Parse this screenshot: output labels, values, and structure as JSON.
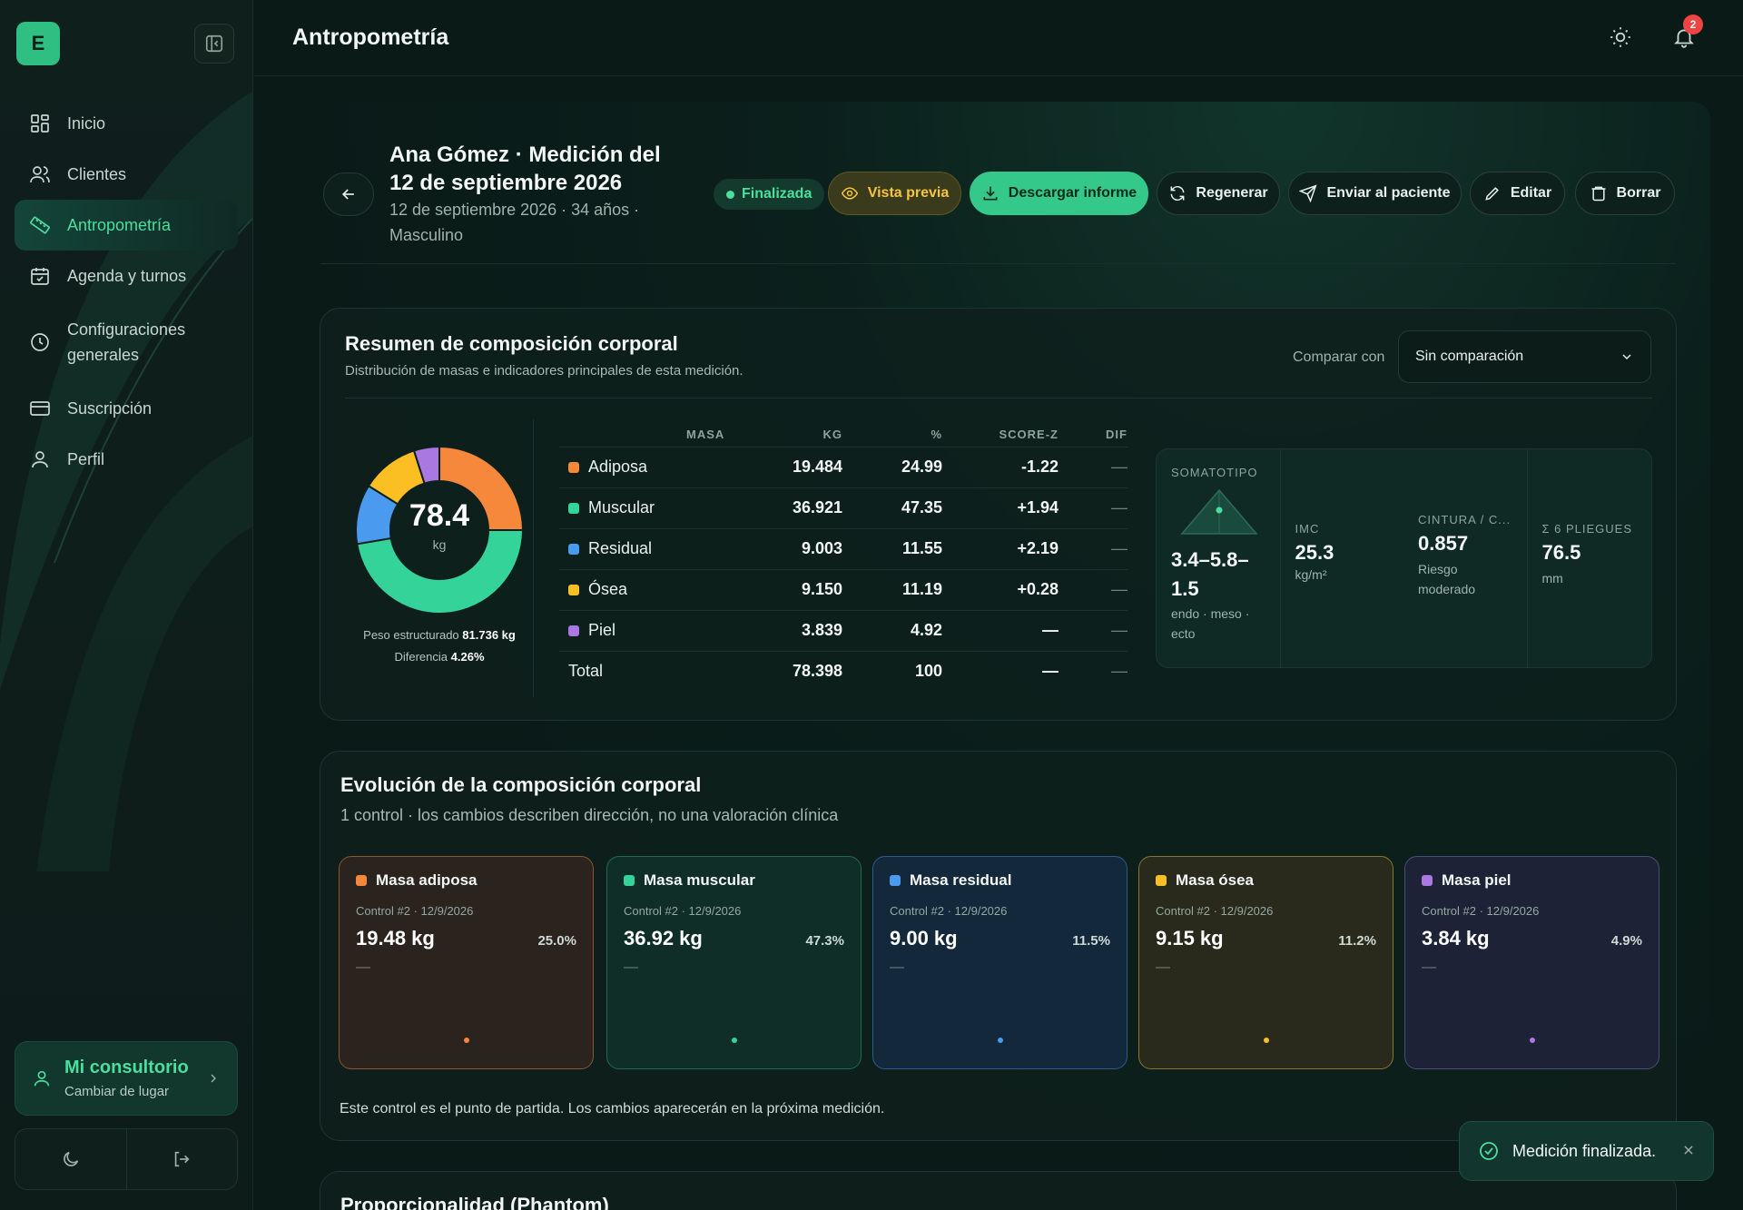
{
  "app": {
    "logo_letter": "E"
  },
  "sidebar": {
    "items": [
      {
        "label": "Inicio",
        "icon": "grid-icon"
      },
      {
        "label": "Clientes",
        "icon": "users-icon"
      },
      {
        "label": "Antropometría",
        "icon": "ruler-icon"
      },
      {
        "label": "Agenda y turnos",
        "icon": "calendar-icon"
      },
      {
        "label": "Configuraciones generales",
        "icon": "clock-icon"
      },
      {
        "label": "Suscripción",
        "icon": "card-icon"
      },
      {
        "label": "Perfil",
        "icon": "user-icon"
      }
    ],
    "active_index": 2,
    "consultorio": {
      "title": "Mi consultorio",
      "subtitle": "Cambiar de lugar"
    }
  },
  "header": {
    "title": "Antropometría",
    "notification_count": "2"
  },
  "patient": {
    "title": "Ana Gómez · Medición del 12 de septiembre 2026",
    "subtitle": "12 de septiembre 2026 · 34 años · Masculino"
  },
  "actions": {
    "status": "Finalizada",
    "preview": "Vista previa",
    "download": "Descargar informe",
    "regenerate": "Regenerar",
    "send": "Enviar al paciente",
    "edit": "Editar",
    "delete": "Borrar"
  },
  "summary": {
    "title": "Resumen de composición corporal",
    "subtitle": "Distribución de masas e indicadores principales de esta medición.",
    "compare_label": "Comparar con",
    "compare_value": "Sin comparación",
    "donut_value": "78.4",
    "donut_unit": "kg",
    "peso_label": "Peso estructurado",
    "peso_value": "81.736 kg",
    "dif_label": "Diferencia",
    "dif_value": "4.26%",
    "columns": [
      "MASA",
      "KG",
      "%",
      "SCORE-Z",
      "DIF"
    ],
    "rows": [
      {
        "name": "Adiposa",
        "kg": "19.484",
        "pct": "24.99",
        "z": "-1.22",
        "dif": "—",
        "color": "#f5883a"
      },
      {
        "name": "Muscular",
        "kg": "36.921",
        "pct": "47.35",
        "z": "+1.94",
        "dif": "—",
        "color": "#34d399"
      },
      {
        "name": "Residual",
        "kg": "9.003",
        "pct": "11.55",
        "z": "+2.19",
        "dif": "—",
        "color": "#4a9bf0"
      },
      {
        "name": "Ósea",
        "kg": "9.150",
        "pct": "11.19",
        "z": "+0.28",
        "dif": "—",
        "color": "#fbbf24"
      },
      {
        "name": "Piel",
        "kg": "3.839",
        "pct": "4.92",
        "z": "—",
        "dif": "—",
        "color": "#a978e0"
      }
    ],
    "total": {
      "name": "Total",
      "kg": "78.398",
      "pct": "100",
      "z": "—",
      "dif": "—"
    },
    "stats": {
      "somatotipo_label": "SOMATOTIPO",
      "somatotipo_value": "3.4–5.8–1.5",
      "somatotipo_caption": "endo · meso · ecto",
      "imc_label": "IMC",
      "imc_value": "25.3",
      "imc_unit": "kg/m²",
      "cintura_label": "CINTURA / C...",
      "cintura_value": "0.857",
      "cintura_caption": "Riesgo moderado",
      "pliegues_label": "Σ 6 PLIEGUES",
      "pliegues_value": "76.5",
      "pliegues_unit": "mm"
    }
  },
  "evolution": {
    "title": "Evolución de la composición corporal",
    "subtitle": "1 control · los cambios describen dirección, no una valoración clínica",
    "cards": [
      {
        "title": "Masa adiposa",
        "control": "Control #2 · 12/9/2026",
        "kg": "19.48 kg",
        "pct": "25.0%",
        "change": "—",
        "color": "#f5883a",
        "bg": "#2b231d",
        "border": "#8a5530"
      },
      {
        "title": "Masa muscular",
        "control": "Control #2 · 12/9/2026",
        "kg": "36.92 kg",
        "pct": "47.3%",
        "change": "—",
        "color": "#34d399",
        "bg": "#0f2e28",
        "border": "#1f6b52"
      },
      {
        "title": "Masa residual",
        "control": "Control #2 · 12/9/2026",
        "kg": "9.00 kg",
        "pct": "11.5%",
        "change": "—",
        "color": "#4a9bf0",
        "bg": "#13283a",
        "border": "#2d5c8c"
      },
      {
        "title": "Masa ósea",
        "control": "Control #2 · 12/9/2026",
        "kg": "9.15 kg",
        "pct": "11.2%",
        "change": "—",
        "color": "#fbbf24",
        "bg": "#2a2a1c",
        "border": "#8a7430"
      },
      {
        "title": "Masa piel",
        "control": "Control #2 · 12/9/2026",
        "kg": "3.84 kg",
        "pct": "4.9%",
        "change": "—",
        "color": "#a978e0",
        "bg": "#1d2236",
        "border": "#4a4f7a"
      }
    ],
    "footnote": "Este control es el punto de partida. Los cambios aparecerán en la próxima medición."
  },
  "next_section": {
    "title": "Proporcionalidad (Phantom)"
  },
  "toast": {
    "message": "Medición finalizada."
  }
}
